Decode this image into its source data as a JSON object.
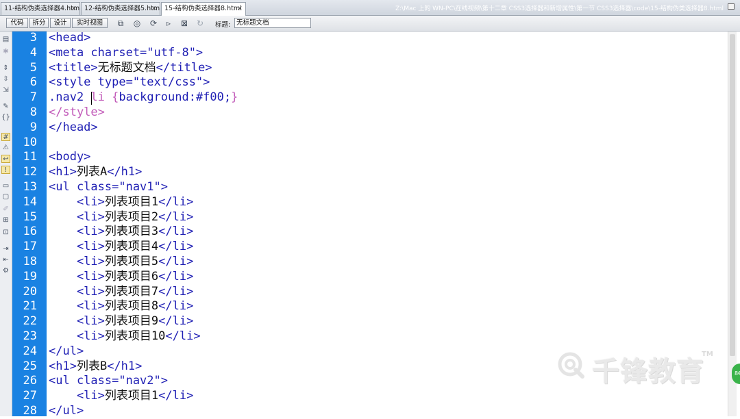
{
  "tabs": [
    {
      "label": "11-结构伪类选择器4.html",
      "active": false
    },
    {
      "label": "12-结构伪类选择器5.html",
      "active": false
    },
    {
      "label": "15-结构伪类选择器8.html",
      "active": true
    }
  ],
  "file_path": "Z:\\Mac 上的 WN-PC\\在线视频\\第十二章 CSS3选择器和新增属性\\第一节 CSS3选择器\\code\\15-结构伪类选择器8.html",
  "toolbar": {
    "view_buttons": [
      "代码",
      "拆分",
      "设计",
      "实时视图"
    ],
    "icons": [
      "file-management-icon",
      "preview-icon",
      "refresh-design-icon",
      "visual-aids-icon",
      "check-page-icon",
      "reload-icon"
    ],
    "title_label": "标题:",
    "title_value": "无标题文档"
  },
  "editor": {
    "gutter_color": "#1a82e2",
    "first_line_number": 3,
    "lines": [
      {
        "n": "3",
        "parts": [
          {
            "t": "<head>",
            "c": "tag"
          }
        ]
      },
      {
        "n": "4",
        "parts": [
          {
            "t": "<meta charset=\"utf-8\">",
            "c": "tag"
          }
        ]
      },
      {
        "n": "5",
        "parts": [
          {
            "t": "<title>",
            "c": "tag"
          },
          {
            "t": "无标题文档",
            "c": "txt"
          },
          {
            "t": "</title>",
            "c": "tag"
          }
        ]
      },
      {
        "n": "6",
        "parts": [
          {
            "t": "<style type=\"text/css\">",
            "c": "tag"
          }
        ]
      },
      {
        "n": "7",
        "parts": [
          {
            "t": ".nav2 ",
            "c": "css-prop"
          },
          {
            "t": "li {",
            "c": "css"
          },
          {
            "t": "background:#f00;",
            "c": "css-prop"
          },
          {
            "t": "}",
            "c": "css"
          }
        ]
      },
      {
        "n": "8",
        "parts": [
          {
            "t": "</style>",
            "c": "css"
          }
        ]
      },
      {
        "n": "9",
        "parts": [
          {
            "t": "</head>",
            "c": "tag"
          }
        ]
      },
      {
        "n": "10",
        "parts": []
      },
      {
        "n": "11",
        "parts": [
          {
            "t": "<body>",
            "c": "tag"
          }
        ]
      },
      {
        "n": "12",
        "parts": [
          {
            "t": "<h1>",
            "c": "tag"
          },
          {
            "t": "列表A",
            "c": "txt"
          },
          {
            "t": "</h1>",
            "c": "tag"
          }
        ]
      },
      {
        "n": "13",
        "parts": [
          {
            "t": "<ul class=\"nav1\">",
            "c": "tag"
          }
        ]
      },
      {
        "n": "14",
        "parts": [
          {
            "t": "    <li>",
            "c": "tag"
          },
          {
            "t": "列表项目1",
            "c": "txt"
          },
          {
            "t": "</li>",
            "c": "tag"
          }
        ]
      },
      {
        "n": "15",
        "parts": [
          {
            "t": "    <li>",
            "c": "tag"
          },
          {
            "t": "列表项目2",
            "c": "txt"
          },
          {
            "t": "</li>",
            "c": "tag"
          }
        ]
      },
      {
        "n": "16",
        "parts": [
          {
            "t": "    <li>",
            "c": "tag"
          },
          {
            "t": "列表项目3",
            "c": "txt"
          },
          {
            "t": "</li>",
            "c": "tag"
          }
        ]
      },
      {
        "n": "17",
        "parts": [
          {
            "t": "    <li>",
            "c": "tag"
          },
          {
            "t": "列表项目4",
            "c": "txt"
          },
          {
            "t": "</li>",
            "c": "tag"
          }
        ]
      },
      {
        "n": "18",
        "parts": [
          {
            "t": "    <li>",
            "c": "tag"
          },
          {
            "t": "列表项目5",
            "c": "txt"
          },
          {
            "t": "</li>",
            "c": "tag"
          }
        ]
      },
      {
        "n": "19",
        "parts": [
          {
            "t": "    <li>",
            "c": "tag"
          },
          {
            "t": "列表项目6",
            "c": "txt"
          },
          {
            "t": "</li>",
            "c": "tag"
          }
        ]
      },
      {
        "n": "20",
        "parts": [
          {
            "t": "    <li>",
            "c": "tag"
          },
          {
            "t": "列表项目7",
            "c": "txt"
          },
          {
            "t": "</li>",
            "c": "tag"
          }
        ]
      },
      {
        "n": "21",
        "parts": [
          {
            "t": "    <li>",
            "c": "tag"
          },
          {
            "t": "列表项目8",
            "c": "txt"
          },
          {
            "t": "</li>",
            "c": "tag"
          }
        ]
      },
      {
        "n": "22",
        "parts": [
          {
            "t": "    <li>",
            "c": "tag"
          },
          {
            "t": "列表项目9",
            "c": "txt"
          },
          {
            "t": "</li>",
            "c": "tag"
          }
        ]
      },
      {
        "n": "23",
        "parts": [
          {
            "t": "    <li>",
            "c": "tag"
          },
          {
            "t": "列表项目10",
            "c": "txt"
          },
          {
            "t": "</li>",
            "c": "tag"
          }
        ]
      },
      {
        "n": "24",
        "parts": [
          {
            "t": "</ul>",
            "c": "tag"
          }
        ]
      },
      {
        "n": "25",
        "parts": [
          {
            "t": "<h1>",
            "c": "tag"
          },
          {
            "t": "列表B",
            "c": "txt"
          },
          {
            "t": "</h1>",
            "c": "tag"
          }
        ]
      },
      {
        "n": "26",
        "parts": [
          {
            "t": "<ul class=\"nav2\">",
            "c": "tag"
          }
        ]
      },
      {
        "n": "27",
        "parts": [
          {
            "t": "    <li>",
            "c": "tag"
          },
          {
            "t": "列表项目1",
            "c": "txt"
          },
          {
            "t": "</li>",
            "c": "tag"
          }
        ]
      },
      {
        "n": "28",
        "parts": [
          {
            "t": "</ul>",
            "c": "tag"
          }
        ]
      }
    ]
  },
  "watermark": {
    "text": "千锋教育",
    "tm": "TM"
  }
}
